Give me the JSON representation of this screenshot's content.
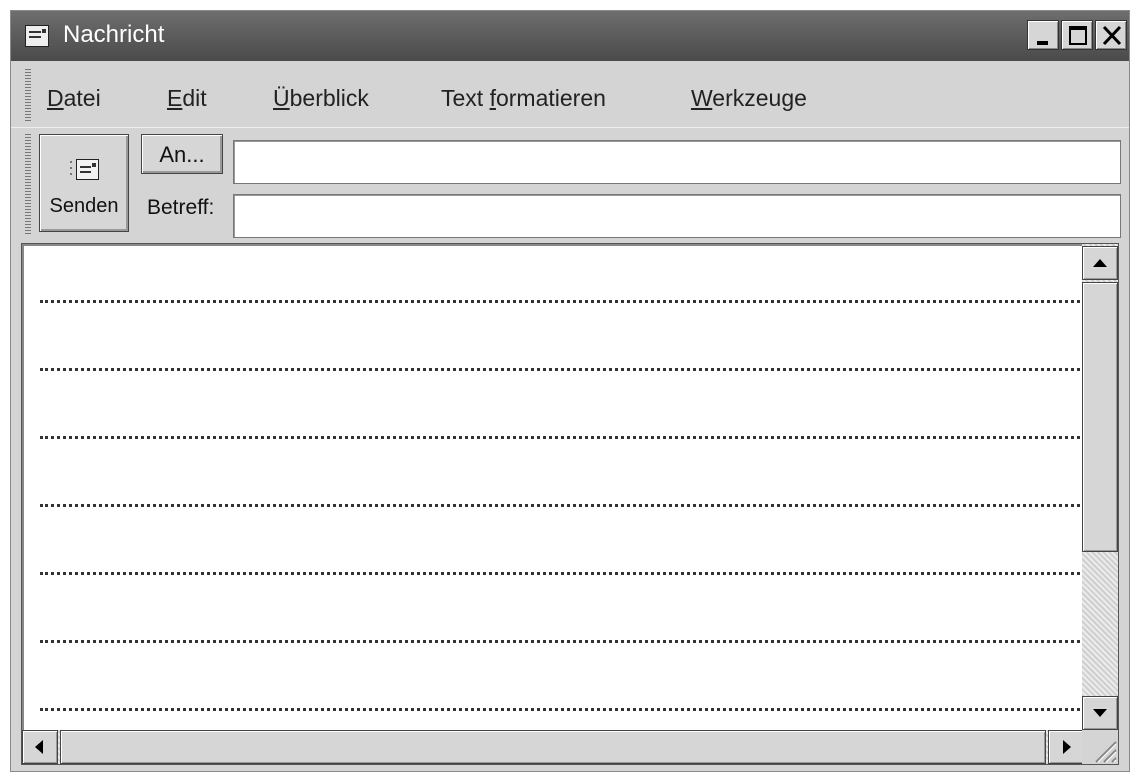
{
  "window": {
    "title": "Nachricht",
    "title_icon": "envelope-icon",
    "controls": [
      "minimize-icon",
      "maximize-icon",
      "close-icon"
    ]
  },
  "menu": {
    "items": [
      {
        "label": "Datei",
        "mnemonic_index": 0
      },
      {
        "label": "Edit",
        "mnemonic_index": 0
      },
      {
        "label": "Überblick",
        "mnemonic_index": 0
      },
      {
        "label": "Text formatieren",
        "mnemonic_index": 5
      },
      {
        "label": "Werkzeuge",
        "mnemonic_index": 0
      }
    ]
  },
  "toolbar": {
    "send_label": "Senden",
    "to_button_label": "An...",
    "to_value": "",
    "subject_label": "Betreff:",
    "subject_value": ""
  },
  "body": {
    "text": ""
  },
  "colors": {
    "titlebar": "#555555",
    "chrome": "#d4d4d4"
  }
}
